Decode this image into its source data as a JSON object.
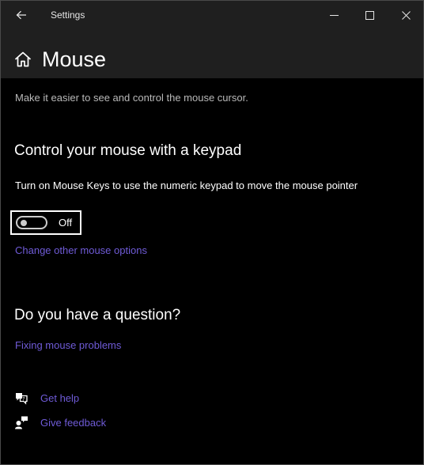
{
  "titlebar": {
    "title": "Settings",
    "back_icon": "arrow-left-icon",
    "minimize_icon": "minimize-icon",
    "maximize_icon": "maximize-icon",
    "close_icon": "close-icon"
  },
  "header": {
    "home_icon": "home-icon",
    "title": "Mouse"
  },
  "subtitle": "Make it easier to see and control the mouse cursor.",
  "keypad_section": {
    "heading": "Control your mouse with a keypad",
    "description": "Turn on Mouse Keys to use the numeric keypad to move the mouse pointer",
    "toggle_state": "Off",
    "toggle_on": false,
    "link": "Change other mouse options"
  },
  "question_section": {
    "heading": "Do you have a question?",
    "link": "Fixing mouse problems"
  },
  "help_links": [
    {
      "icon": "get-help-icon",
      "label": "Get help"
    },
    {
      "icon": "feedback-icon",
      "label": "Give feedback"
    }
  ],
  "colors": {
    "background": "#000000",
    "titlebar": "#1f1f1f",
    "link": "#6f5bd7",
    "text": "#ffffff",
    "subtle_text": "#b9b9b9"
  }
}
